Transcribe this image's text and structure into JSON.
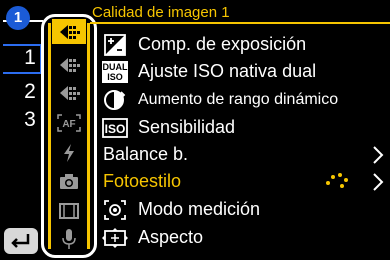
{
  "nav": {
    "page_badge": "1",
    "pages": [
      "1",
      "2",
      "3"
    ]
  },
  "tabs": [
    {
      "name": "image-quality-tab",
      "icon": "camera-brightness-icon",
      "active": true
    },
    {
      "name": "focus-tab",
      "icon": "camera-brightness-icon",
      "active": false
    },
    {
      "name": "flash-tab",
      "icon": "camera-brightness-icon",
      "active": false
    },
    {
      "name": "af-tab",
      "icon": "af-icon",
      "active": false
    },
    {
      "name": "flash-light-tab",
      "icon": "lightning-icon",
      "active": false
    },
    {
      "name": "shooting-tab",
      "icon": "camera-icon",
      "active": false
    },
    {
      "name": "video-tab",
      "icon": "film-icon",
      "active": false
    },
    {
      "name": "audio-tab",
      "icon": "microphone-icon",
      "active": false
    }
  ],
  "header": {
    "title": "Calidad de imagen 1"
  },
  "menu": {
    "items": [
      {
        "label": "Comp. de exposición",
        "icon": "exposure-comp-icon"
      },
      {
        "label": "Ajuste ISO nativa dual",
        "icon": "dual-iso-icon",
        "icon_text": [
          "DUAL",
          "ISO"
        ]
      },
      {
        "label": "Aumento de rango dinámico",
        "icon": "dynamic-range-icon"
      },
      {
        "label": "Sensibilidad",
        "icon": "iso-icon",
        "icon_text": "ISO"
      },
      {
        "label": "Balance b."
      },
      {
        "label": "Fotoestilo",
        "highlighted": true
      },
      {
        "label": "Modo medición",
        "icon": "metering-icon"
      },
      {
        "label": "Aspecto",
        "icon": "aspect-icon"
      }
    ]
  },
  "colors": {
    "accent": "#f6c500",
    "selection_blue": "#2c6df0",
    "badge_blue": "#1b5bd6",
    "background": "#000000"
  }
}
